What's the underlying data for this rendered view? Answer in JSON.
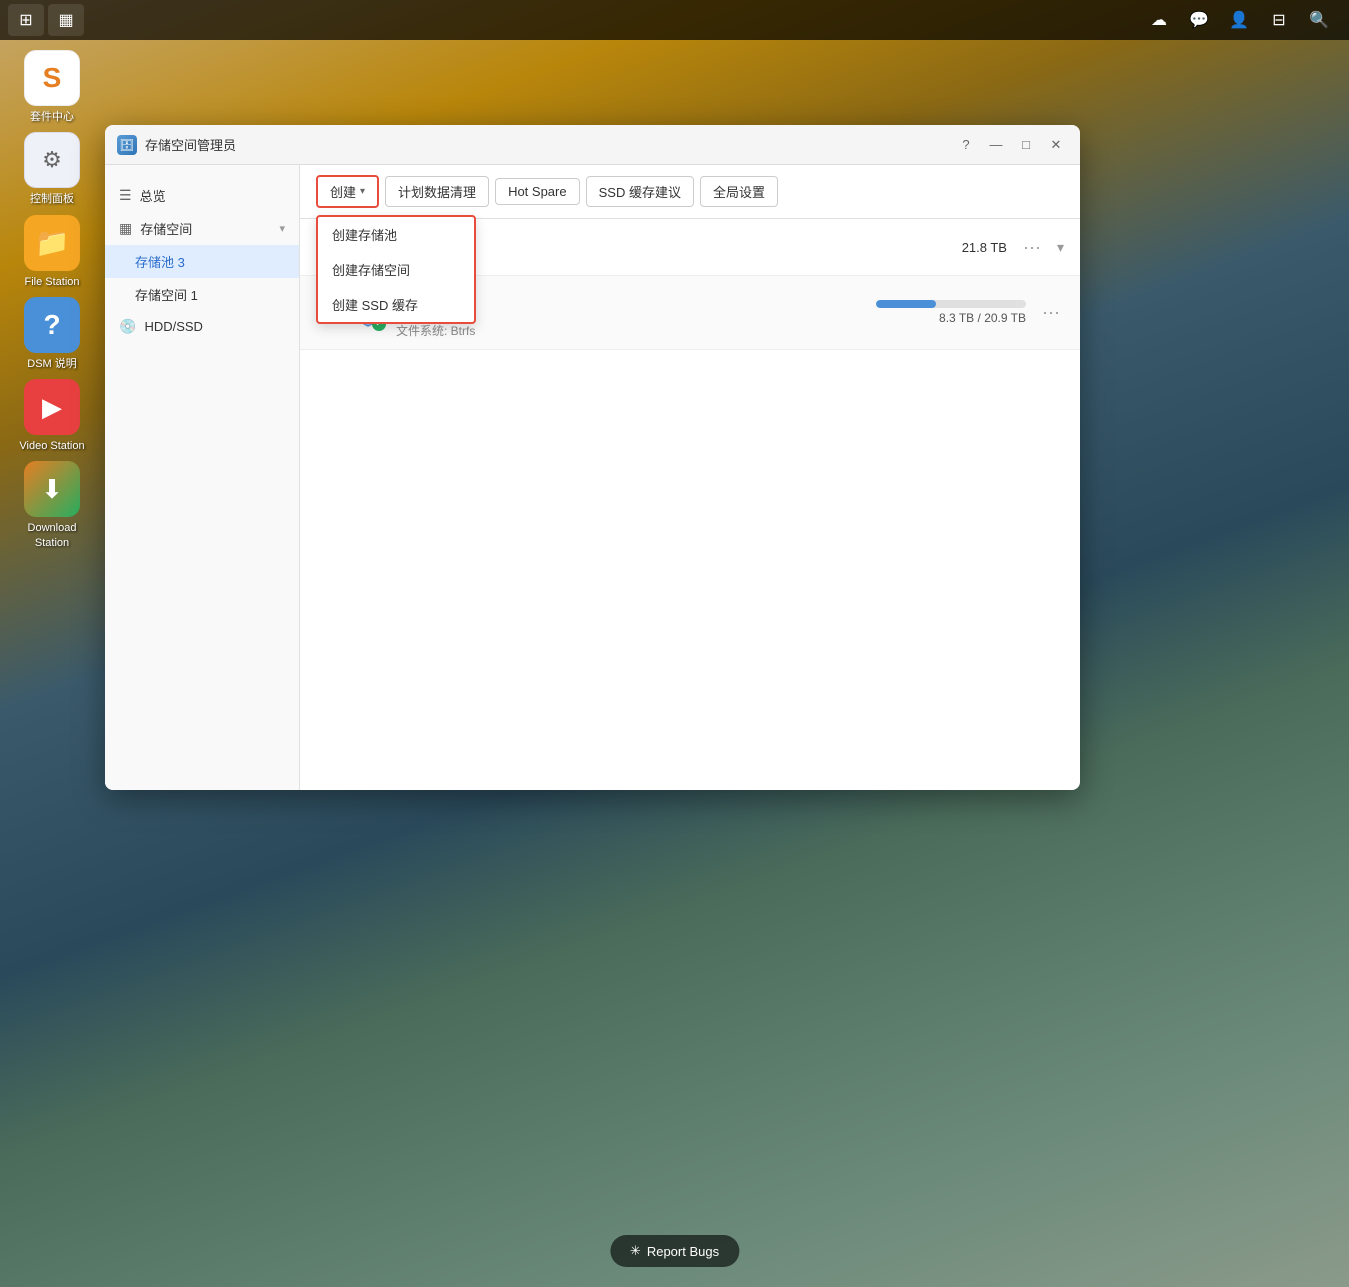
{
  "desktop": {
    "taskbar": {
      "left_btn1_icon": "⊞",
      "left_btn2_icon": "▦"
    },
    "right_icons": [
      "☁",
      "💬",
      "👤",
      "⊟",
      "🔍"
    ],
    "icons": [
      {
        "id": "pkg-center",
        "label": "套件中心",
        "bg": "#ffffff",
        "emoji": "S",
        "color": "#e67e22"
      },
      {
        "id": "control-panel",
        "label": "控制面板",
        "bg": "#f0f0f0",
        "emoji": "⚙",
        "color": "#555"
      },
      {
        "id": "file-station",
        "label": "File Station",
        "bg": "#f5a623",
        "emoji": "📁",
        "color": "white"
      },
      {
        "id": "dsm-help",
        "label": "DSM 说明",
        "bg": "#4a90d9",
        "emoji": "?",
        "color": "white"
      },
      {
        "id": "video-station",
        "label": "Video Station",
        "bg": "#e84040",
        "emoji": "▶",
        "color": "white"
      },
      {
        "id": "download-station",
        "label": "Download Station",
        "bg": "#27ae60",
        "emoji": "⬇",
        "color": "white"
      }
    ]
  },
  "window": {
    "title": "存储空间管理员",
    "title_icon": "🗄",
    "controls": {
      "help": "?",
      "minimize": "—",
      "restore": "□",
      "close": "✕"
    },
    "sidebar": {
      "items": [
        {
          "id": "overview",
          "label": "总览",
          "icon": "≡",
          "indent": false,
          "active": false
        },
        {
          "id": "storage-space-group",
          "label": "存储空间",
          "icon": "▦",
          "indent": false,
          "active": false,
          "has_chevron": true
        },
        {
          "id": "storage-pool-3",
          "label": "存储池 3",
          "icon": "",
          "indent": true,
          "active": true
        },
        {
          "id": "storage-space-1",
          "label": "存储空间 1",
          "icon": "",
          "indent": true,
          "active": false
        },
        {
          "id": "hdd-ssd",
          "label": "HDD/SSD",
          "icon": "💿",
          "indent": false,
          "active": false
        }
      ]
    },
    "toolbar": {
      "create_label": "创建",
      "schedule_label": "计划数据清理",
      "hot_spare_label": "Hot Spare",
      "ssd_cache_label": "SSD 缓存建议",
      "global_settings_label": "全局设置"
    },
    "dropdown": {
      "items": [
        {
          "id": "create-pool",
          "label": "创建存储池"
        },
        {
          "id": "create-space",
          "label": "创建存储空间"
        },
        {
          "id": "create-ssd",
          "label": "创建 SSD 缓存"
        }
      ]
    },
    "pool": {
      "name": "存储池 3",
      "size": "21.8 TB",
      "icon": "cube"
    },
    "volume": {
      "name": "存储空间 1",
      "status": "良好",
      "filesystem": "文件系统: Btrfs",
      "used": "8.3 TB",
      "total": "20.9 TB",
      "usage_pct": 40
    }
  },
  "report_bugs": {
    "label": "Report Bugs",
    "icon": "✳"
  }
}
